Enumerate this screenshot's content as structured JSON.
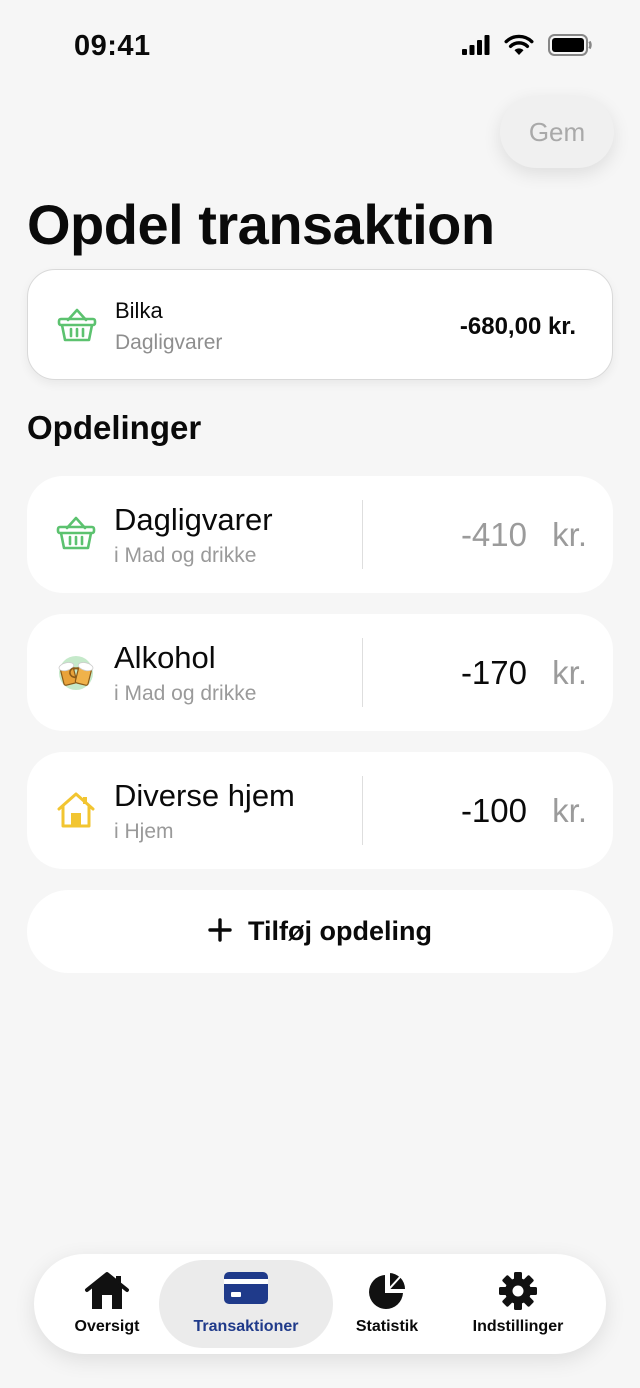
{
  "status_bar": {
    "time": "09:41"
  },
  "header": {
    "save_label": "Gem",
    "title": "Opdel transaktion"
  },
  "transaction": {
    "name": "Bilka",
    "category": "Dagligvarer",
    "amount": "-680,00 kr.",
    "icon": "basket-icon"
  },
  "splits_title": "Opdelinger",
  "splits": [
    {
      "name": "Dagligvarer",
      "subcategory": "i Mad og drikke",
      "amount": "-410",
      "currency": "kr.",
      "icon": "basket-icon",
      "amount_muted": true
    },
    {
      "name": "Alkohol",
      "subcategory": "i Mad og drikke",
      "amount": "-170",
      "currency": "kr.",
      "icon": "beer-mugs-icon",
      "amount_muted": false
    },
    {
      "name": "Diverse hjem",
      "subcategory": "i Hjem",
      "amount": "-100",
      "currency": "kr.",
      "icon": "house-icon",
      "amount_muted": false
    }
  ],
  "add_split_label": "Tilføj opdeling",
  "tab_bar": {
    "tabs": [
      {
        "label": "Oversigt",
        "icon": "home-icon",
        "active": false
      },
      {
        "label": "Transaktioner",
        "icon": "card-icon",
        "active": true
      },
      {
        "label": "Statistik",
        "icon": "pie-chart-icon",
        "active": false
      },
      {
        "label": "Indstillinger",
        "icon": "gear-icon",
        "active": false
      }
    ]
  },
  "colors": {
    "accent": "#1f3a8a",
    "basket": "#5cc26f",
    "house": "#f2c531",
    "muted_text": "#9b9b9b"
  }
}
